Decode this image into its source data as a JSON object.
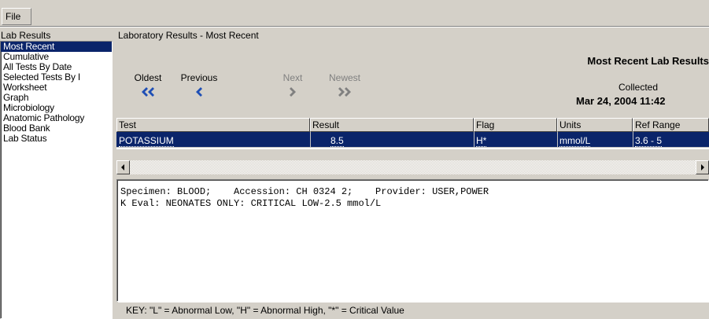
{
  "menu": {
    "file_label": "File"
  },
  "left": {
    "label": "Lab Results",
    "items": [
      "Most Recent",
      "Cumulative",
      "All Tests By Date",
      "Selected Tests By I",
      "Worksheet",
      "Graph",
      "Microbiology",
      "Anatomic Pathology",
      "Blood Bank",
      "Lab Status"
    ],
    "selected_index": 0
  },
  "right": {
    "title": "Laboratory Results - Most Recent",
    "nav": {
      "oldest": "Oldest",
      "previous": "Previous",
      "next": "Next",
      "newest": "Newest"
    },
    "header_title": "Most Recent Lab Results",
    "collected_label": "Collected",
    "collected_date": "Mar 24, 2004 11:42"
  },
  "grid": {
    "columns": [
      "Test",
      "Result",
      "Flag",
      "Units",
      "Ref Range"
    ],
    "rows": [
      {
        "test": "POTASSIUM",
        "result": "8.5",
        "flag": "H*",
        "units": "mmol/L",
        "ref_range": "3.6 - 5"
      }
    ]
  },
  "memo": {
    "line1": "Specimen: BLOOD;    Accession: CH 0324 2;    Provider: USER,POWER",
    "line2": "K Eval: NEONATES ONLY: CRITICAL LOW-2.5 mmol/L"
  },
  "key": "KEY: \"L\" = Abnormal Low, \"H\" = Abnormal High, \"*\" = Critical Value",
  "colors": {
    "selection": "#0a246a",
    "nav_arrow": "#1f4fb5",
    "disabled": "#808080"
  }
}
